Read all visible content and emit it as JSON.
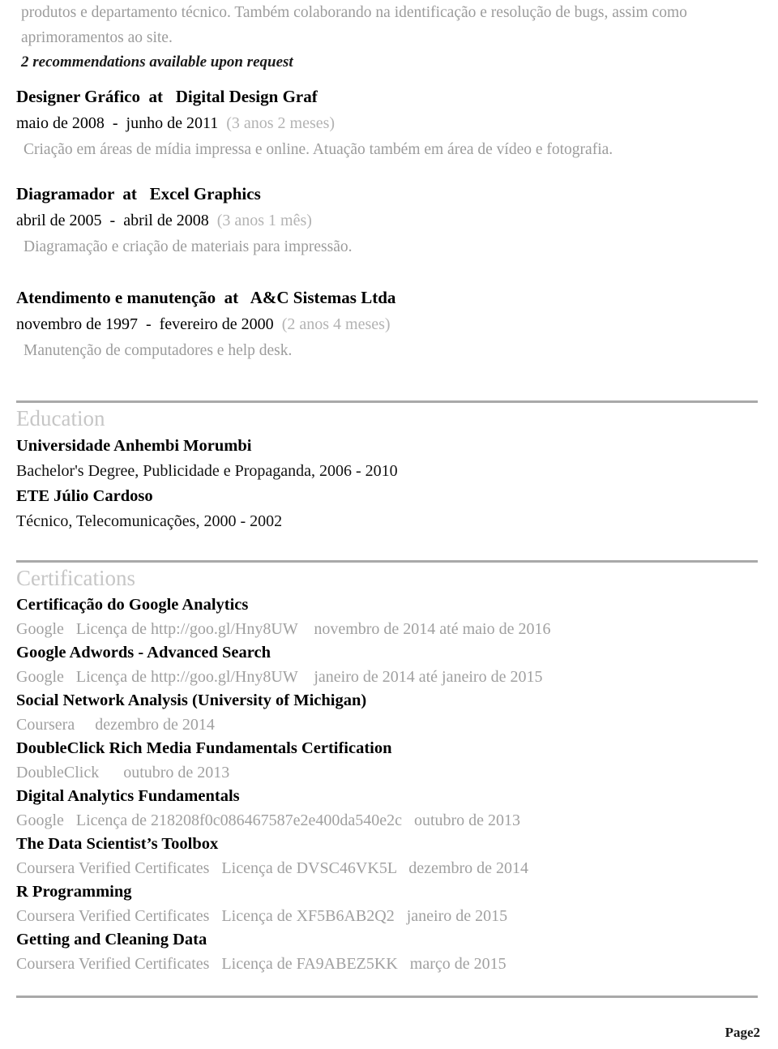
{
  "document": {
    "type": "resume",
    "page_label": "Page2"
  },
  "top_paragraph": {
    "text": "produtos e departamento técnico. Também colaborando na identificação e resolução de bugs, assim como aprimoramentos ao site."
  },
  "recommendations_note": {
    "text": "2 recommendations available upon request"
  },
  "experience": {
    "entries": [
      {
        "title": "Designer Gráfico  at   Digital Design Graf",
        "dates": "maio de 2008  -  junho de 2011  ",
        "duration": "(3 anos 2 meses)",
        "description": "Criação em áreas de mídia impressa e online. Atuação também em área de vídeo e fotografia."
      },
      {
        "title": "Diagramador  at   Excel Graphics",
        "dates": "abril de 2005  -  abril de 2008  ",
        "duration": "(3 anos 1 mês)",
        "description": "Diagramação e criação de materiais para impressão."
      },
      {
        "title": "Atendimento e manutenção  at   A&C Sistemas Ltda",
        "dates": "novembro de 1997  -  fevereiro de 2000  ",
        "duration": "(2 anos 4 meses)",
        "description": "Manutenção de computadores e help desk."
      }
    ]
  },
  "education": {
    "heading": "Education",
    "entries": [
      {
        "school": "Universidade Anhembi Morumbi",
        "detail": "Bachelor's Degree, Publicidade e Propaganda, 2006 - 2010"
      },
      {
        "school": "ETE Júlio Cardoso",
        "detail": "Técnico, Telecomunicações, 2000 - 2002"
      }
    ]
  },
  "certifications": {
    "heading": "Certifications",
    "entries": [
      {
        "name": "Certificação do Google Analytics",
        "meta": "Google   Licença de http://goo.gl/Hny8UW    novembro de 2014 até maio de 2016"
      },
      {
        "name": "Google Adwords - Advanced Search",
        "meta": "Google   Licença de http://goo.gl/Hny8UW    janeiro de 2014 até janeiro de 2015"
      },
      {
        "name": "Social Network Analysis (University of Michigan)",
        "meta": "Coursera     dezembro de 2014"
      },
      {
        "name": "DoubleClick Rich Media Fundamentals Certification",
        "meta": "DoubleClick      outubro de 2013"
      },
      {
        "name": "Digital Analytics Fundamentals",
        "meta": "Google   Licença de 218208f0c086467587e2e400da540e2c   outubro de 2013"
      },
      {
        "name": "The Data Scientist’s Toolbox",
        "meta": "Coursera Verified Certificates   Licença de DVSC46VK5L   dezembro de 2014"
      },
      {
        "name": "R Programming",
        "meta": "Coursera Verified Certificates   Licença de XF5B6AB2Q2   janeiro de 2015"
      },
      {
        "name": "Getting and Cleaning Data",
        "meta": "Coursera Verified Certificates   Licença de FA9ABEZ5KK   março de 2015"
      }
    ]
  },
  "colors": {
    "body_text": "#000000",
    "muted_text": "#9c9c9c",
    "section_heading": "#c6c6c6",
    "separator": "#a9a9a9",
    "background": "#ffffff"
  }
}
